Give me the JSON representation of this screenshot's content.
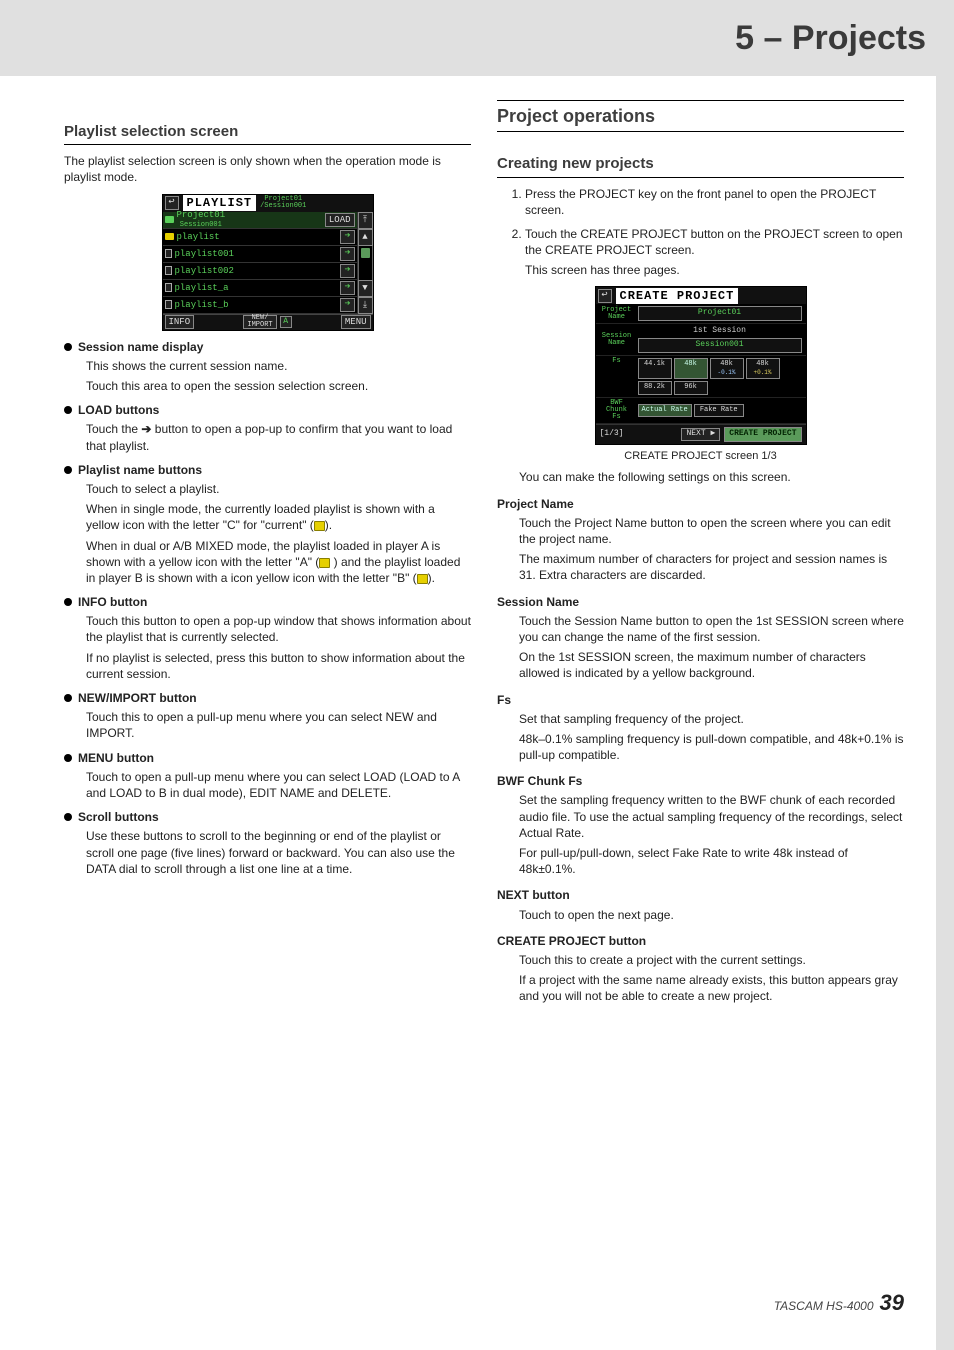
{
  "header": {
    "title": "5 – Projects"
  },
  "footer": {
    "model": "TASCAM HS-4000",
    "page": "39"
  },
  "left": {
    "h3": "Playlist selection screen",
    "intro": "The playlist selection screen is only shown when the operation mode is playlist mode.",
    "fig1": {
      "back_glyph": "↩",
      "title": "PLAYLIST",
      "crumb1": "Project01",
      "crumb2": "/Session001",
      "row_project": "Project01",
      "row_session": "Session001",
      "load_label": "LOAD",
      "rows": [
        "playlist",
        "playlist001",
        "playlist002",
        "playlist_a",
        "playlist_b"
      ],
      "foot_info": "INFO",
      "foot_new": "NEW/",
      "foot_import": "IMPORT",
      "foot_menu": "MENU",
      "foot_ab": "A",
      "scroll_top": "⤒",
      "scroll_up": "▲",
      "scroll_down": "▼",
      "scroll_bottom": "⤓"
    },
    "b1": {
      "head": "Session name display",
      "p1": "This shows the current session name.",
      "p2": "Touch this area to open the session selection screen."
    },
    "b2": {
      "head": " LOAD buttons",
      "p1a": "Touch the ",
      "p1b": " button to open a pop-up to confirm that you want to load that playlist."
    },
    "b3": {
      "head": "Playlist name buttons",
      "p1": "Touch to select a playlist.",
      "p2a": "When in single mode, the currently loaded playlist is shown with a yellow icon with the letter \"C\" for \"current\" (",
      "p2b": ").",
      "p3a": "When in dual or A/B MIXED mode, the playlist loaded in player A is shown with a yellow icon with the letter \"A\" (",
      "p3b": " ) and the playlist loaded in player B is shown with a icon yellow icon with the letter \"B\" (",
      "p3c": ")."
    },
    "b4": {
      "head": "INFO button",
      "p1": "Touch this button to open a pop-up window that shows information about the playlist that is currently selected.",
      "p2": "If no playlist is selected, press this button to show information about the current session."
    },
    "b5": {
      "head": "NEW/IMPORT button",
      "p1": "Touch this to open a pull-up menu where you can select NEW and IMPORT."
    },
    "b6": {
      "head": "MENU button",
      "p1": "Touch to open a pull-up menu where you can select LOAD (LOAD to A and LOAD to B in dual mode), EDIT NAME and DELETE."
    },
    "b7": {
      "head": "Scroll buttons",
      "p1": "Use these buttons to scroll to the beginning or end of the playlist or scroll one page (five lines) forward or backward. You can also use the DATA dial to scroll through a list one line at a time."
    }
  },
  "right": {
    "h2": "Project operations",
    "h3": "Creating new projects",
    "step1": "Press the PROJECT key on the front panel to open the PROJECT screen.",
    "step2a": "Touch the CREATE PROJECT button on the PROJECT screen to open the CREATE PROJECT screen.",
    "step2b": "This screen has three pages.",
    "fig2": {
      "back_glyph": "↩",
      "title": "CREATE PROJECT",
      "lbl_project": "Project\nName",
      "val_project": "Project01",
      "lbl_session": "Session\nName",
      "session_sub": "1st Session",
      "val_session": "Session001",
      "lbl_fs": "Fs",
      "fs": [
        "44.1k",
        "48k",
        "48k",
        "48k",
        "88.2k",
        "96k"
      ],
      "fs_neg": "-0.1%",
      "fs_pos": "+0.1%",
      "lbl_bwf": "BWF\nChunk\nFs",
      "bwf": [
        "Actual Rate",
        "Fake Rate"
      ],
      "page": "[1/3]",
      "next": "NEXT",
      "next_arrow": "▶",
      "create": "CREATE PROJECT"
    },
    "fig2_caption": "CREATE PROJECT screen 1/3",
    "after_fig": "You can make the following settings on this screen.",
    "d1": {
      "term": "Project Name",
      "p1": "Touch the Project Name button to open the screen where you can edit the project name.",
      "p2": "The maximum number of characters for project and session names is 31. Extra characters are discarded."
    },
    "d2": {
      "term": "Session Name",
      "p1": "Touch the Session Name button to open the 1st SESSION screen where you can change the name of the first session.",
      "p2": "On the 1st SESSION screen, the maximum number of characters allowed is indicated by a yellow background."
    },
    "d3": {
      "term": "Fs",
      "p1": "Set that sampling frequency of the project.",
      "p2": "48k–0.1% sampling frequency is pull-down compatible, and 48k+0.1% is pull-up compatible."
    },
    "d4": {
      "term": "BWF Chunk Fs",
      "p1": "Set the sampling frequency written to the BWF chunk of each recorded audio file. To use the actual sampling frequency of the recordings, select Actual Rate.",
      "p2": "For pull-up/pull-down, select Fake Rate to write 48k instead of 48k±0.1%."
    },
    "d5": {
      "term": "NEXT button",
      "p1": "Touch to open the next page."
    },
    "d6": {
      "term": "CREATE PROJECT button",
      "p1": "Touch this to create a project with the current settings.",
      "p2": "If a project with the same name already exists, this button appears gray and you will not be able to create a new project."
    }
  }
}
